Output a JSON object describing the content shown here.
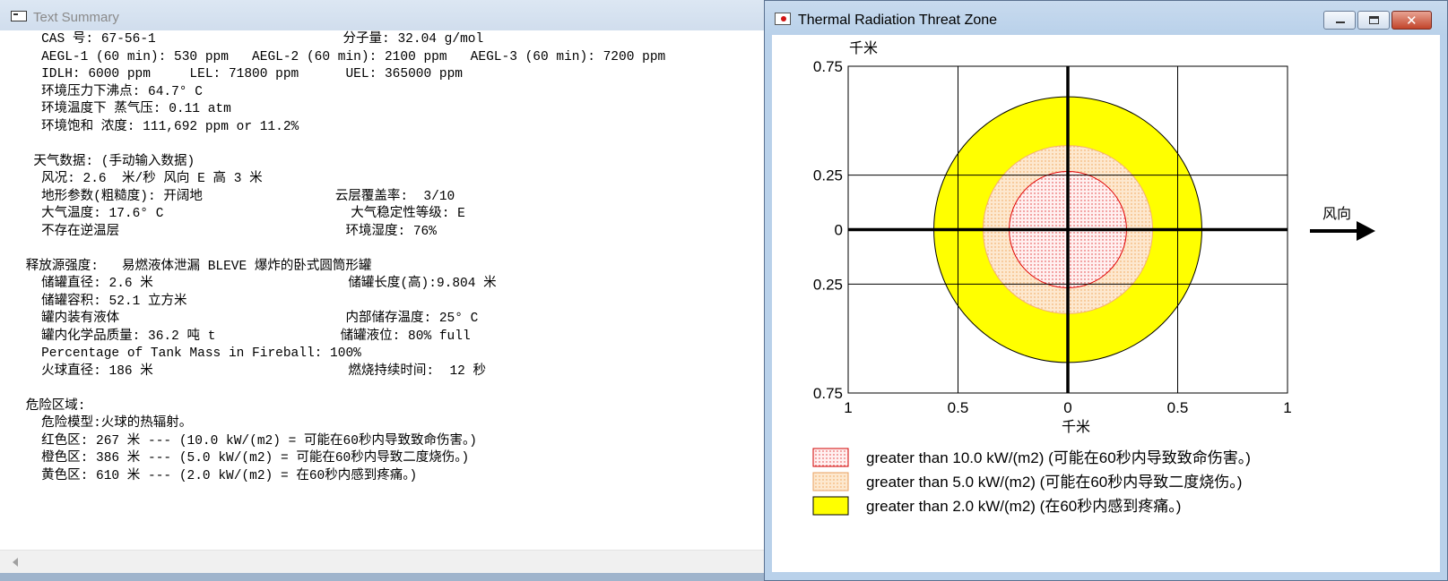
{
  "left_window": {
    "title": "Text Summary",
    "lines": [
      "   CAS 号: 67-56-1                        分子量: 32.04 g/mol",
      "   AEGL-1 (60 min): 530 ppm   AEGL-2 (60 min): 2100 ppm   AEGL-3 (60 min): 7200 ppm",
      "   IDLH: 6000 ppm     LEL: 71800 ppm      UEL: 365000 ppm",
      "   环境压力下沸点: 64.7° C",
      "   环境温度下 蒸气压: 0.11 atm",
      "   环境饱和 浓度: 111,692 ppm or 11.2%",
      "",
      "  天气数据: (手动输入数据)",
      "   风况: 2.6  米/秒 风向 E 高 3 米",
      "   地形参数(粗糙度): 开阔地                 云层覆盖率:  3/10",
      "   大气温度: 17.6° C                        大气稳定性等级: E",
      "   不存在逆温层                             环境湿度: 76%",
      "",
      " 释放源强度:   易燃液体泄漏 BLEVE 爆炸的卧式圆筒形罐",
      "   储罐直径: 2.6 米                         储罐长度(高):9.804 米",
      "   储罐容积: 52.1 立方米",
      "   罐内装有液体                             内部储存温度: 25° C",
      "   罐内化学品质量: 36.2 吨 t                储罐液位: 80% full",
      "   Percentage of Tank Mass in Fireball: 100%",
      "   火球直径: 186 米                         燃烧持续时间:  12 秒",
      "",
      " 危险区域:",
      "   危险模型:火球的热辐射。",
      "   红色区: 267 米 --- (10.0 kW/(m2) = 可能在60秒内导致致命伤害。)",
      "   橙色区: 386 米 --- (5.0 kW/(m2) = 可能在60秒内导致二度烧伤。)",
      "   黄色区: 610 米 --- (2.0 kW/(m2) = 在60秒内感到疼痛。)"
    ]
  },
  "right_window": {
    "title": "Thermal Radiation Threat Zone",
    "buttons": {
      "minimize": "",
      "maximize": "",
      "close": "✕"
    },
    "wind_label": "风向",
    "legend": [
      {
        "text": "greater than 10.0 kW/(m2) (可能在60秒内导致致命伤害。)",
        "color": "#ff0000",
        "style": "dotted-red"
      },
      {
        "text": "greater than 5.0 kW/(m2) (可能在60秒内导致二度烧伤。)",
        "color": "#f5a34a",
        "style": "dotted-orange"
      },
      {
        "text": "greater than 2.0 kW/(m2) (在60秒内感到疼痛。)",
        "color": "#ffff00",
        "style": "solid-yellow"
      }
    ]
  },
  "chart_data": {
    "type": "threat-zone",
    "xlabel": "千米",
    "ylabel": "千米",
    "xlim": [
      -1,
      1
    ],
    "ylim": [
      -0.75,
      0.75
    ],
    "x_ticks": [
      {
        "value": -1,
        "label": "1"
      },
      {
        "value": -0.5,
        "label": "0.5"
      },
      {
        "value": 0,
        "label": "0"
      },
      {
        "value": 0.5,
        "label": "0.5"
      },
      {
        "value": 1,
        "label": "1"
      }
    ],
    "y_ticks": [
      {
        "value": 0.75,
        "label": "0.75"
      },
      {
        "value": 0.25,
        "label": "0.25"
      },
      {
        "value": 0,
        "label": "0"
      },
      {
        "value": -0.25,
        "label": "0.25"
      },
      {
        "value": -0.75,
        "label": "0.75"
      }
    ],
    "zones": [
      {
        "name": "黄色区",
        "radius_km": 0.61,
        "fill": "#ffff00"
      },
      {
        "name": "橙色区",
        "radius_km": 0.386,
        "fill": "#fbe0c0"
      },
      {
        "name": "红色区",
        "radius_km": 0.267,
        "fill": "#ffe6e6"
      }
    ]
  }
}
